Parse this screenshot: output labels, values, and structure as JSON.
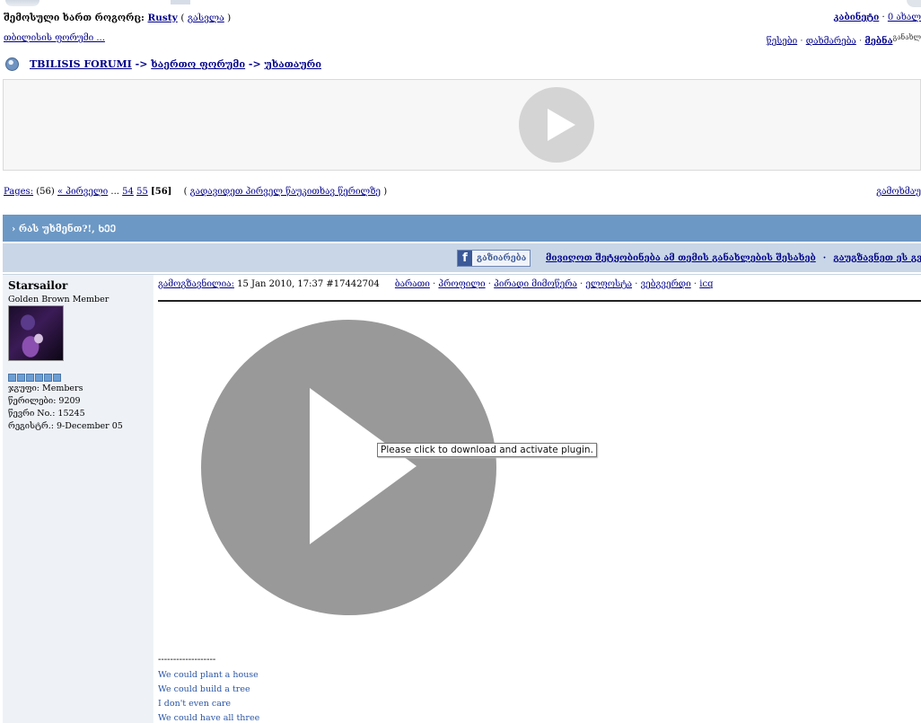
{
  "header": {
    "logged_in_label": "შემოსული ხართ როგორც:",
    "username": "Rusty",
    "logout_prefix": "( ",
    "logout_label": "გასვლა",
    "logout_suffix": " )",
    "inbox_label": "კაბინეტი",
    "inbox_sep": " · ",
    "inbox_link": "0 ახალ"
  },
  "subheader": {
    "my_link": "თბილისის ფორუმი ...",
    "nav": [
      "წესები",
      "დახმარება",
      "მებნა"
    ],
    "nav_extra": "განახლ"
  },
  "breadcrumb": {
    "items": [
      "TBILISIS FORUMI",
      "ხაერთო ფორუმი",
      "უხათაური"
    ],
    "separator": " -> "
  },
  "pagination": {
    "label": "Pages:",
    "count": "(56)",
    "first": "« პირველი",
    "ellipsis": " ... ",
    "pages": [
      "54",
      "55"
    ],
    "current": "[56]",
    "unread_open": "( ",
    "unread": "გადავიდეთ პირველ წაუკითხავ წერილზე",
    "unread_close": " )",
    "right_link": "გამოხმაუ"
  },
  "topic": {
    "title": "› რას უხმენთ?!, ᲮᲔᲔ"
  },
  "share": {
    "fb_icon": "f",
    "fb_label": "გაზიარება",
    "links": [
      "მივიღოთ შეტყობინება ამ თემის განახლების შესახებ",
      "გაუგზავნეთ ეს გვ"
    ]
  },
  "post": {
    "author": "Starsailor",
    "member_title": "Golden Brown Member",
    "rank_pips": 6,
    "group": "ჯგუფი: Members",
    "posts": "წერილები: 9209",
    "member_no": "წევრი No.: 15245",
    "registered": "რეგისტრ.: 9-December 05",
    "posted_label": "გამოგზავნილია:",
    "posted_date": " 15 Jan 2010, 17:37",
    "post_id": " #17442704",
    "actions": [
      "ბარათი",
      "პროფილი",
      "პირადი მიმოწერა",
      "ელფოსტა",
      "ვებგვერდი",
      "icq"
    ],
    "plugin_tooltip": "Please click to download and activate plugin.",
    "signature_dashes": "-------------------",
    "signature": [
      "We could plant a house",
      "We could build a tree",
      "I don't even care",
      "We could have all three"
    ]
  }
}
